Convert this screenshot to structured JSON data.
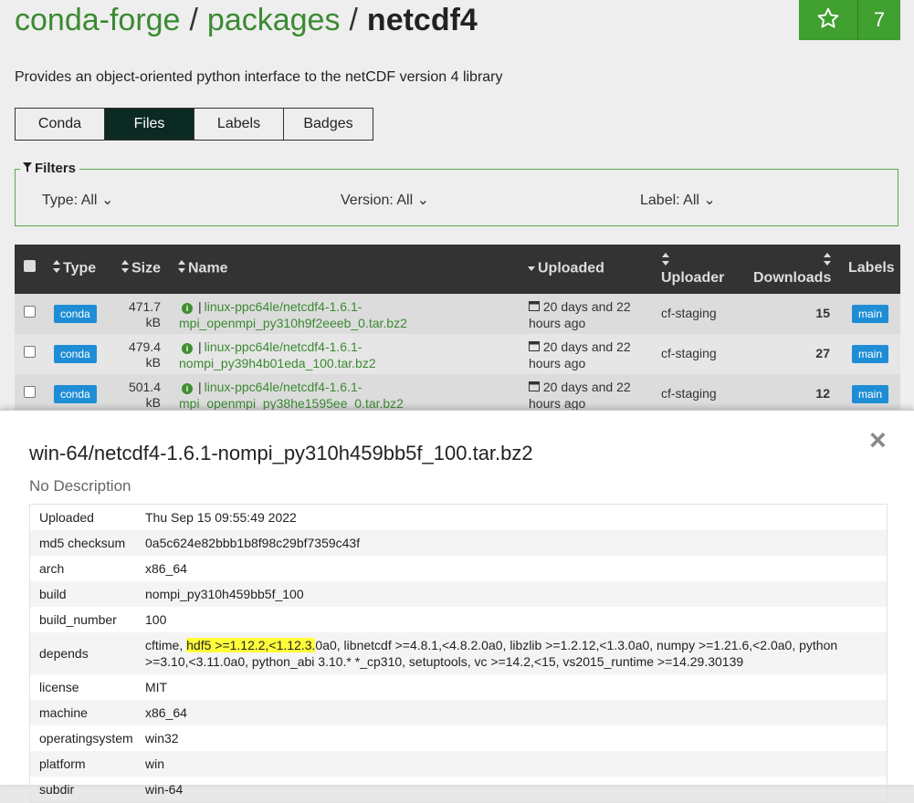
{
  "breadcrumb": {
    "org": "conda-forge",
    "sep1": "/",
    "section": "packages",
    "sep2": "/",
    "package": "netcdf4"
  },
  "star": {
    "icon": "star-icon",
    "count": "7"
  },
  "description": "Provides an object-oriented python interface to the netCDF version 4 library",
  "tabs": [
    {
      "label": "Conda"
    },
    {
      "label": "Files",
      "active": true
    },
    {
      "label": "Labels"
    },
    {
      "label": "Badges"
    }
  ],
  "filters": {
    "legend": "Filters",
    "type": "Type: All",
    "version": "Version: All",
    "label": "Label: All"
  },
  "table": {
    "headers": {
      "type": "Type",
      "size": "Size",
      "name": "Name",
      "uploaded": "Uploaded",
      "uploader": "Uploader",
      "downloads": "Downloads",
      "labels": "Labels"
    },
    "rows": [
      {
        "type": "conda",
        "size1": "471.7",
        "size2": "kB",
        "name1": "linux-ppc64le/netcdf4-1.6.1-",
        "name2": "mpi_openmpi_py310h9f2eeeb_0.tar.bz2",
        "up1": "20 days and 22",
        "up2": "hours ago",
        "uploader": "cf-staging",
        "downloads": "15",
        "label": "main"
      },
      {
        "type": "conda",
        "size1": "479.4",
        "size2": "kB",
        "name1": "linux-ppc64le/netcdf4-1.6.1-",
        "name2": "nompi_py39h4b01eda_100.tar.bz2",
        "up1": "20 days and 22",
        "up2": "hours ago",
        "uploader": "cf-staging",
        "downloads": "27",
        "label": "main"
      },
      {
        "type": "conda",
        "size1": "501.4",
        "size2": "kB",
        "name1": "linux-ppc64le/netcdf4-1.6.1-",
        "name2": "mpi_openmpi_py38he1595ee_0.tar.bz2",
        "up1": "20 days and 22",
        "up2": "hours ago",
        "uploader": "cf-staging",
        "downloads": "12",
        "label": "main"
      }
    ]
  },
  "modal": {
    "close": "×",
    "title": "win-64/netcdf4-1.6.1-nompi_py310h459bb5f_100.tar.bz2",
    "subtitle": "No Description",
    "fields": {
      "uploaded": {
        "key": "Uploaded",
        "value": "Thu Sep 15 09:55:49 2022"
      },
      "md5": {
        "key": "md5 checksum",
        "value": "0a5c624e82bbb1b8f98c29bf7359c43f"
      },
      "arch": {
        "key": "arch",
        "value": "x86_64"
      },
      "build": {
        "key": "build",
        "value": "nompi_py310h459bb5f_100"
      },
      "build_number": {
        "key": "build_number",
        "value": "100"
      },
      "depends": {
        "key": "depends",
        "pre": "cftime, ",
        "highlight": "hdf5 >=1.12.2,<1.12.3.",
        "post": "0a0, libnetcdf >=4.8.1,<4.8.2.0a0, libzlib >=1.2.12,<1.3.0a0, numpy >=1.21.6,<2.0a0, python >=3.10,<3.11.0a0, python_abi 3.10.* *_cp310, setuptools, vc >=14.2,<15, vs2015_runtime >=14.29.30139"
      },
      "license": {
        "key": "license",
        "value": "MIT"
      },
      "machine": {
        "key": "machine",
        "value": "x86_64"
      },
      "os": {
        "key": "operatingsystem",
        "value": "win32"
      },
      "platform": {
        "key": "platform",
        "value": "win"
      },
      "subdir": {
        "key": "subdir",
        "value": "win-64"
      }
    }
  }
}
